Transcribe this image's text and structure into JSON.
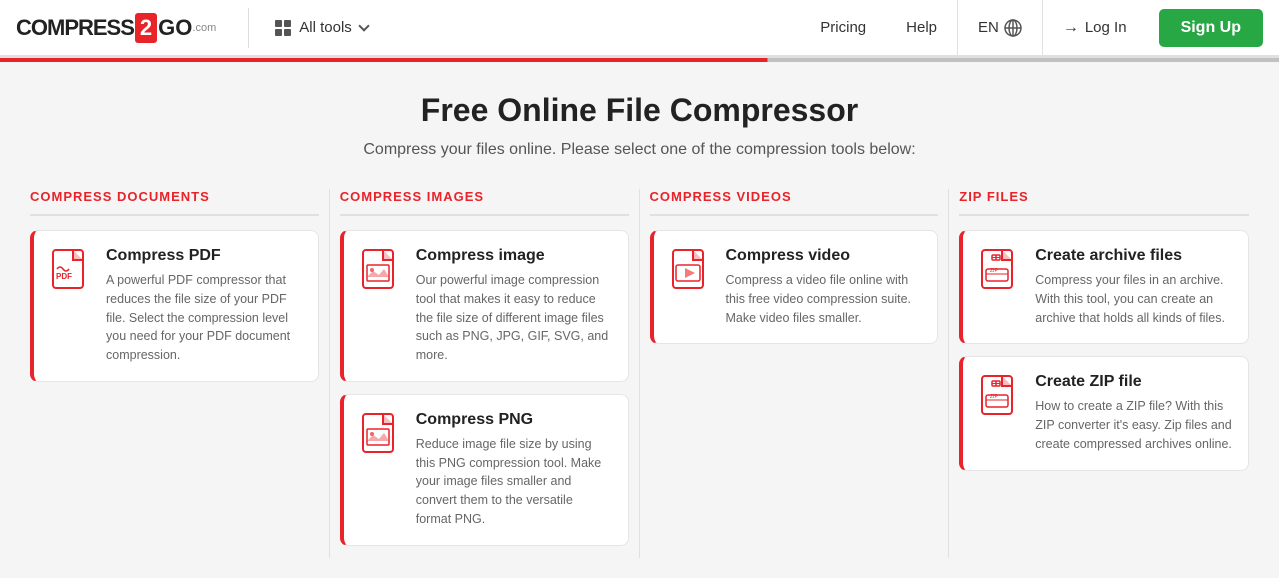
{
  "header": {
    "logo_compress": "COMPRESS",
    "logo_2": "2",
    "logo_go": "GO",
    "logo_com": ".com",
    "all_tools_label": "All tools",
    "nav_pricing": "Pricing",
    "nav_help": "Help",
    "lang": "EN",
    "login_label": "Log In",
    "signup_label": "Sign Up"
  },
  "page": {
    "title": "Free Online File Compressor",
    "subtitle": "Compress your files online. Please select one of the compression tools below:"
  },
  "sections": [
    {
      "id": "compress-documents",
      "header": "COMPRESS DOCUMENTS",
      "cards": [
        {
          "title": "Compress PDF",
          "desc": "A powerful PDF compressor that reduces the file size of your PDF file. Select the compression level you need for your PDF document compression.",
          "icon_type": "pdf"
        }
      ]
    },
    {
      "id": "compress-images",
      "header": "COMPRESS IMAGES",
      "cards": [
        {
          "title": "Compress image",
          "desc": "Our powerful image compression tool that makes it easy to reduce the file size of different image files such as PNG, JPG, GIF, SVG, and more.",
          "icon_type": "image"
        },
        {
          "title": "Compress PNG",
          "desc": "Reduce image file size by using this PNG compression tool. Make your image files smaller and convert them to the versatile format PNG.",
          "icon_type": "png"
        }
      ]
    },
    {
      "id": "compress-videos",
      "header": "COMPRESS VIDEOS",
      "cards": [
        {
          "title": "Compress video",
          "desc": "Compress a video file online with this free video compression suite. Make video files smaller.",
          "icon_type": "video"
        }
      ]
    },
    {
      "id": "zip-files",
      "header": "ZIP FILES",
      "cards": [
        {
          "title": "Create archive files",
          "desc": "Compress your files in an archive. With this tool, you can create an archive that holds all kinds of files.",
          "icon_type": "archive"
        },
        {
          "title": "Create ZIP file",
          "desc": "How to create a ZIP file? With this ZIP converter it's easy. Zip files and create compressed archives online.",
          "icon_type": "zip"
        }
      ]
    }
  ]
}
